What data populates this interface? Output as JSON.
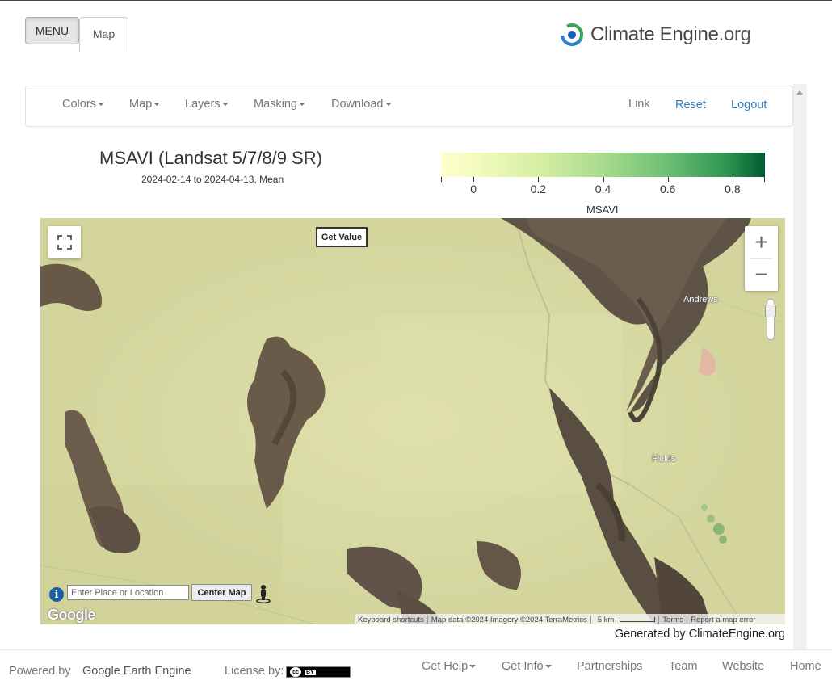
{
  "top": {
    "menu_label": "MENU",
    "tab_label": "Map"
  },
  "logo": {
    "brand": "Climate Engine",
    "suffix": ".org"
  },
  "navbar": {
    "left_items": [
      "Colors",
      "Map",
      "Layers",
      "Masking",
      "Download"
    ],
    "link_label": "Link",
    "reset_label": "Reset",
    "logout_label": "Logout"
  },
  "map_header": {
    "title": "MSAVI (Landsat 5/7/8/9 SR)",
    "subtitle": "2024-02-14 to 2024-04-13, Mean"
  },
  "legend": {
    "name": "MSAVI",
    "tick_labels": [
      "0",
      "0.2",
      "0.4",
      "0.6",
      "0.8"
    ],
    "min_value": -0.1,
    "max_value": 0.9,
    "colors": [
      "#ffffcc",
      "#d6efa3",
      "#a8db8e",
      "#6cbe74",
      "#2e9650",
      "#005a32"
    ]
  },
  "map": {
    "get_value_label": "Get Value",
    "zoom_in": "+",
    "zoom_out": "−",
    "place_labels": [
      "Andrews",
      "Fields"
    ],
    "search_placeholder": "Enter Place or Location",
    "center_button": "Center Map",
    "google_logo": "Google",
    "attribution": {
      "shortcuts": "Keyboard shortcuts",
      "data": "Map data ©2024 Imagery ©2024 TerraMetrics",
      "scale": "5 km",
      "terms": "Terms",
      "report": "Report a map error"
    }
  },
  "generated_by": "Generated by ClimateEngine.org",
  "footer": {
    "powered_by": "Powered by",
    "gee_label": "Google Earth Engine",
    "license_label": "License by:",
    "cc_label": "cc",
    "by_label": "BY",
    "nav": [
      "Get Help",
      "Get Info",
      "Partnerships",
      "Team",
      "Website",
      "Home"
    ]
  },
  "colors": {
    "link_blue": "#337ab7",
    "text_gray": "#777777"
  },
  "icons": [
    "fullscreen-icon",
    "info-icon",
    "pegman-icon",
    "scroll-up-icon",
    "climate-engine-logo-icon"
  ]
}
